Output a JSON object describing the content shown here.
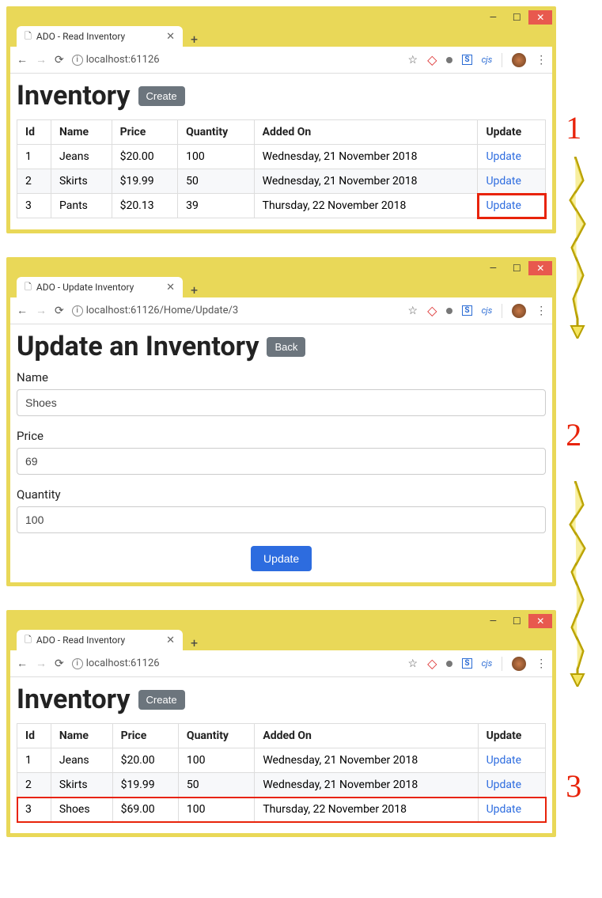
{
  "steps": {
    "one": "1",
    "two": "2",
    "three": "3"
  },
  "window1": {
    "tab_title": "ADO - Read Inventory",
    "url": "localhost:61126",
    "heading": "Inventory",
    "create_btn": "Create",
    "headers": {
      "id": "Id",
      "name": "Name",
      "price": "Price",
      "qty": "Quantity",
      "added": "Added On",
      "update": "Update"
    },
    "rows": [
      {
        "id": "1",
        "name": "Jeans",
        "price": "$20.00",
        "qty": "100",
        "added": "Wednesday, 21 November 2018",
        "update": "Update"
      },
      {
        "id": "2",
        "name": "Skirts",
        "price": "$19.99",
        "qty": "50",
        "added": "Wednesday, 21 November 2018",
        "update": "Update"
      },
      {
        "id": "3",
        "name": "Pants",
        "price": "$20.13",
        "qty": "39",
        "added": "Thursday, 22 November 2018",
        "update": "Update"
      }
    ]
  },
  "window2": {
    "tab_title": "ADO - Update Inventory",
    "url": "localhost:61126/Home/Update/3",
    "heading": "Update an Inventory",
    "back_btn": "Back",
    "labels": {
      "name": "Name",
      "price": "Price",
      "qty": "Quantity"
    },
    "values": {
      "name": "Shoes",
      "price": "69",
      "qty": "100"
    },
    "submit": "Update"
  },
  "window3": {
    "tab_title": "ADO - Read Inventory",
    "url": "localhost:61126",
    "heading": "Inventory",
    "create_btn": "Create",
    "headers": {
      "id": "Id",
      "name": "Name",
      "price": "Price",
      "qty": "Quantity",
      "added": "Added On",
      "update": "Update"
    },
    "rows": [
      {
        "id": "1",
        "name": "Jeans",
        "price": "$20.00",
        "qty": "100",
        "added": "Wednesday, 21 November 2018",
        "update": "Update"
      },
      {
        "id": "2",
        "name": "Skirts",
        "price": "$19.99",
        "qty": "50",
        "added": "Wednesday, 21 November 2018",
        "update": "Update"
      },
      {
        "id": "3",
        "name": "Shoes",
        "price": "$69.00",
        "qty": "100",
        "added": "Thursday, 22 November 2018",
        "update": "Update"
      }
    ]
  },
  "glyphs": {
    "min": "—",
    "max": "☐",
    "close": "✕",
    "plus": "+",
    "back": "←",
    "fwd": "→",
    "reload": "⟳",
    "star": "☆",
    "info": "i",
    "dots": "⋮",
    "diamond": "◇",
    "file": "🗋",
    "s": "S",
    "cjs": "cjs"
  }
}
